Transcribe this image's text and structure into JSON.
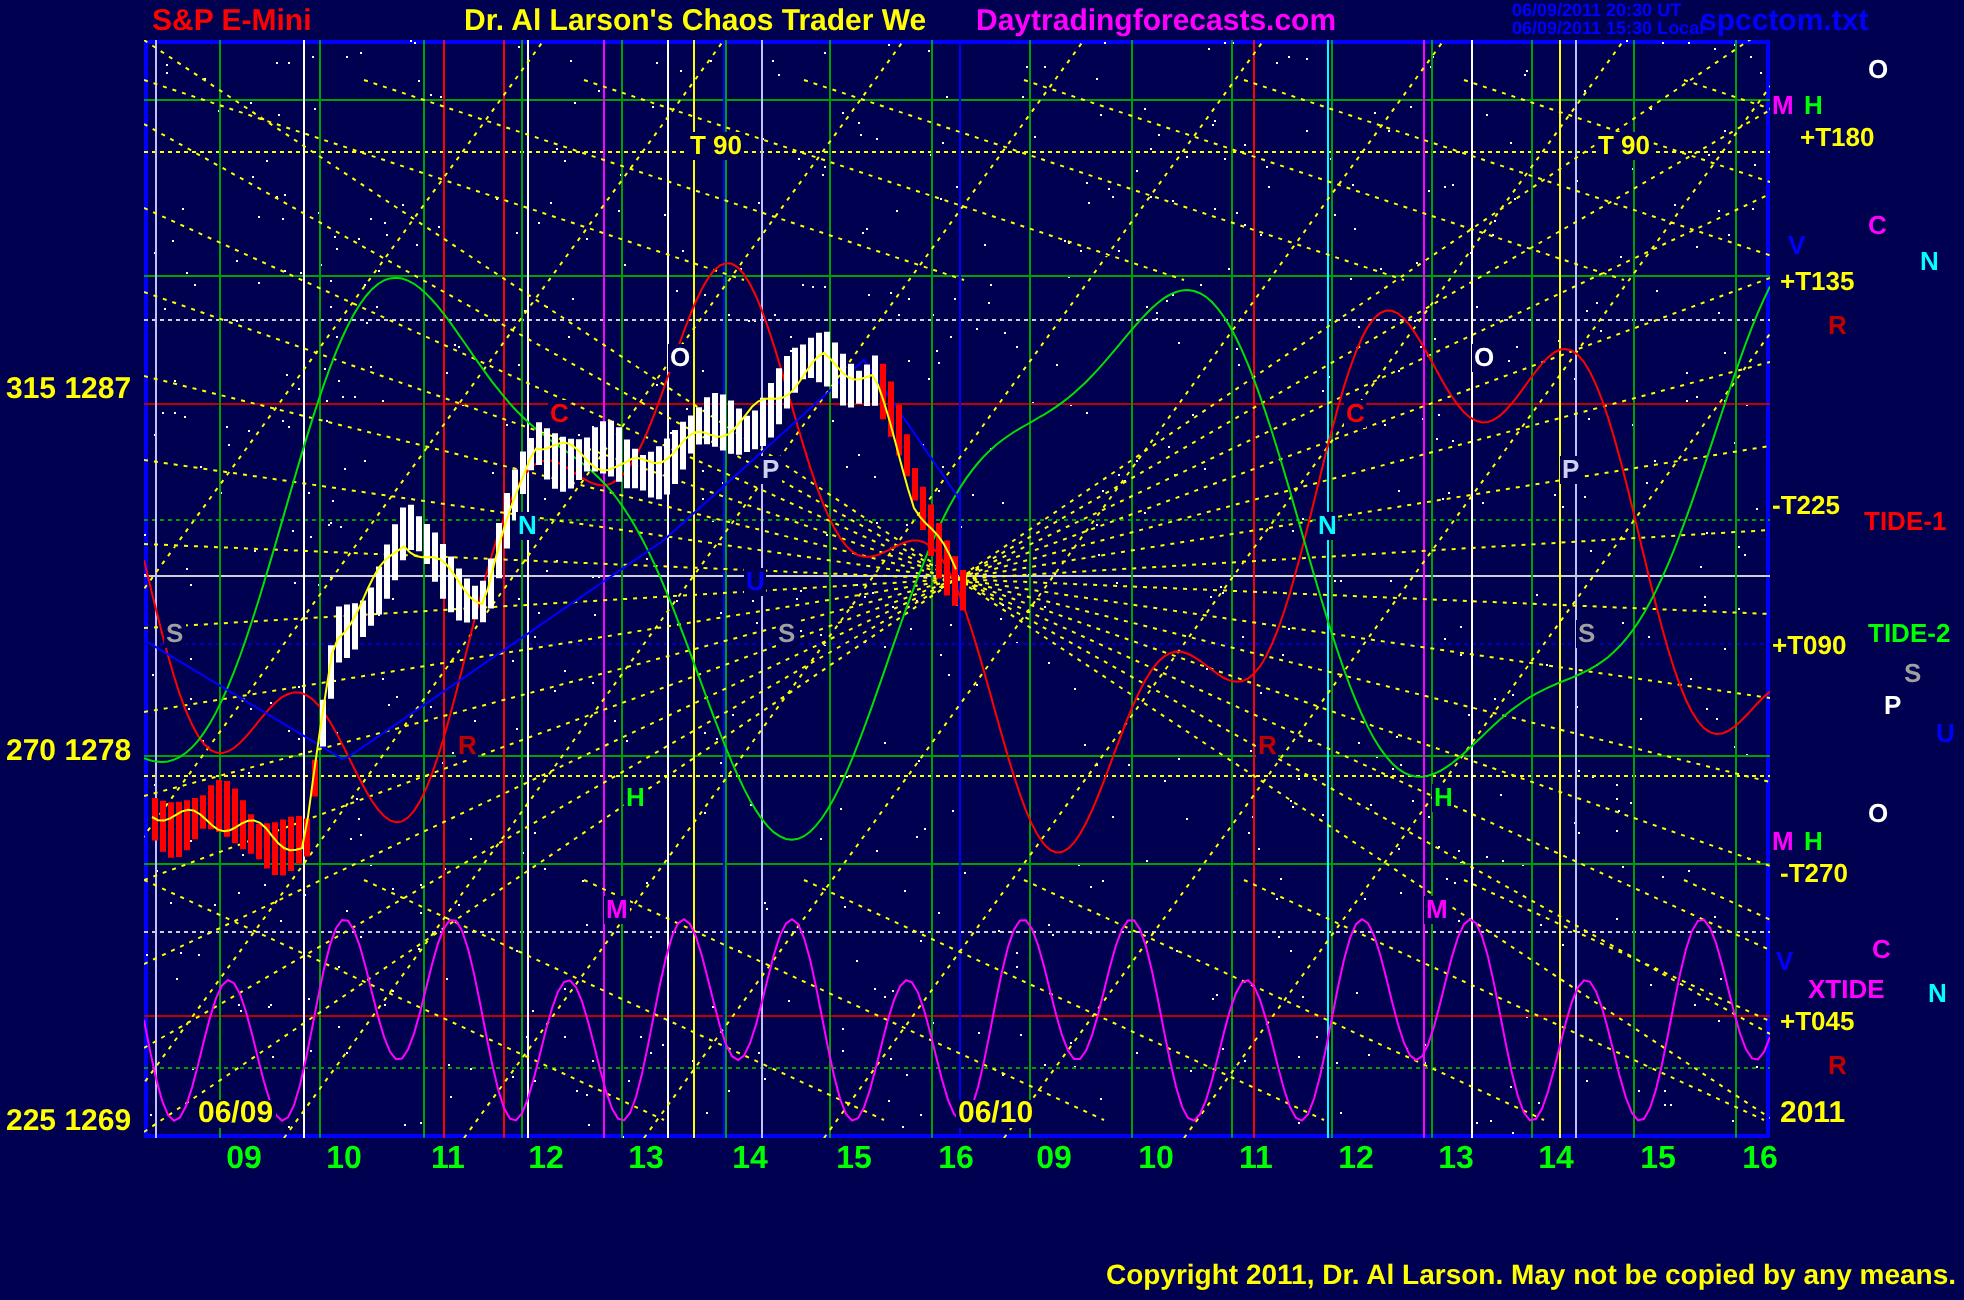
{
  "header": {
    "symbol": "S&P E-Mini",
    "title": "Dr. Al Larson's Chaos Trader We",
    "site": "Daytradingforecasts.com",
    "time_ut": "06/09/2011 20:30 UT",
    "time_local": "06/09/2011 15:30 Local",
    "file": "spcctom.txt"
  },
  "y_axis": [
    "315 1287",
    "270 1278",
    "225 1269"
  ],
  "date_labels": [
    "06/09",
    "06/10",
    "2011"
  ],
  "hour_labels": [
    "09",
    "10",
    "11",
    "12",
    "13",
    "14",
    "15",
    "16",
    "09",
    "10",
    "11",
    "12",
    "13",
    "14",
    "15",
    "16"
  ],
  "plot_markers": [
    {
      "text": "T 90",
      "color": "#ffff00"
    },
    {
      "text": "T 90",
      "color": "#ffff00"
    },
    {
      "text": "O",
      "color": "#ffffff"
    },
    {
      "text": "O",
      "color": "#ffffff"
    },
    {
      "text": "P",
      "color": "#d0d0f0"
    },
    {
      "text": "P",
      "color": "#d0d0f0"
    },
    {
      "text": "N",
      "color": "#00ffff"
    },
    {
      "text": "N",
      "color": "#00ffff"
    },
    {
      "text": "C",
      "color": "#ff0000"
    },
    {
      "text": "C",
      "color": "#ff0000"
    },
    {
      "text": "S",
      "color": "#a0a0a0"
    },
    {
      "text": "S",
      "color": "#a0a0a0"
    },
    {
      "text": "S",
      "color": "#a0a0a0"
    },
    {
      "text": "R",
      "color": "#c00000"
    },
    {
      "text": "R",
      "color": "#c00000"
    },
    {
      "text": "H",
      "color": "#00ff00"
    },
    {
      "text": "H",
      "color": "#00ff00"
    },
    {
      "text": "M",
      "color": "#ff00ff"
    },
    {
      "text": "M",
      "color": "#ff00ff"
    },
    {
      "text": "U",
      "color": "#0000ff"
    }
  ],
  "right_labels": [
    {
      "text": "O",
      "color": "#ffffff"
    },
    {
      "text": "M",
      "color": "#ff00ff"
    },
    {
      "text": "H",
      "color": "#00ff00"
    },
    {
      "text": "+T180",
      "color": "#ffff00"
    },
    {
      "text": "C",
      "color": "#ff00ff"
    },
    {
      "text": "V",
      "color": "#0000ff"
    },
    {
      "text": "N",
      "color": "#00ffff"
    },
    {
      "text": "+T135",
      "color": "#ffff00"
    },
    {
      "text": "R",
      "color": "#c00000"
    },
    {
      "text": "-T225",
      "color": "#ffff00"
    },
    {
      "text": "TIDE-1",
      "color": "#ff0000"
    },
    {
      "text": "+T090",
      "color": "#ffff00"
    },
    {
      "text": "TIDE-2",
      "color": "#00ff00"
    },
    {
      "text": "S",
      "color": "#a0a0a0"
    },
    {
      "text": "P",
      "color": "#ffffff"
    },
    {
      "text": "U",
      "color": "#0000ff"
    },
    {
      "text": "O",
      "color": "#ffffff"
    },
    {
      "text": "M",
      "color": "#ff00ff"
    },
    {
      "text": "H",
      "color": "#00ff00"
    },
    {
      "text": "-T270",
      "color": "#ffff00"
    },
    {
      "text": "V",
      "color": "#0000ff"
    },
    {
      "text": "C",
      "color": "#ff00ff"
    },
    {
      "text": "XTIDE",
      "color": "#ff00ff"
    },
    {
      "text": "N",
      "color": "#00ffff"
    },
    {
      "text": "+T045",
      "color": "#ffff00"
    },
    {
      "text": "R",
      "color": "#c00000"
    }
  ],
  "copyright": "Copyright 2011, Dr. Al Larson. May not be copied by any means."
}
